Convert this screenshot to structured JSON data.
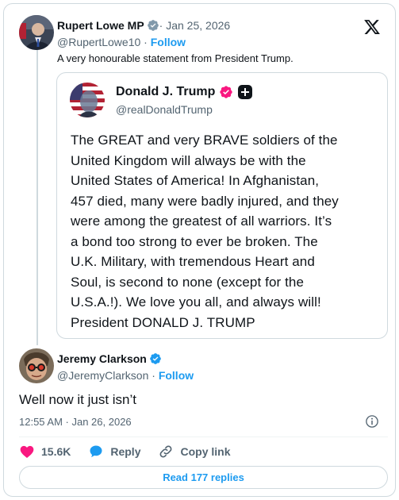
{
  "parent": {
    "name": "Rupert Lowe MP",
    "date": " · Jan 25, 2026",
    "handle": "@RupertLowe10",
    "separator": " · ",
    "follow": "Follow",
    "text": "A very honourable statement from President Trump."
  },
  "quote": {
    "name": "Donald J. Trump",
    "handle": "@realDonaldTrump",
    "lines": [
      "The GREAT and very BRAVE soldiers of the",
      "United Kingdom will always be with the",
      "United States of America! In Afghanistan,",
      "457 died, many were badly injured, and they",
      "were among the greatest of all warriors. It’s",
      "a bond too strong to ever be broken. The",
      "U.K. Military, with tremendous Heart and",
      "Soul, is second to none (except for the",
      "U.S.A.!). We love you all, and always will!",
      "President DONALD J. TRUMP"
    ]
  },
  "reply": {
    "name": "Jeremy Clarkson",
    "handle": "@JeremyClarkson",
    "separator": " · ",
    "follow": "Follow",
    "text": "Well now it just isn’t",
    "timestamp": "12:55 AM · Jan 26, 2026"
  },
  "actions": {
    "likes": "15.6K",
    "reply": "Reply",
    "copy_link": "Copy link"
  },
  "read_replies": "Read 177 replies",
  "icons": {
    "verified": "verified-badge-icon",
    "x_logo": "x-logo-icon",
    "heart": "heart-icon",
    "reply": "reply-bubble-icon",
    "link": "link-icon",
    "info": "info-icon"
  },
  "colors": {
    "accent": "#1d9bf0",
    "like": "#f91880",
    "text": "#0f1419",
    "muted": "#536471",
    "border": "#cfd9de",
    "affiliate_badge": "#f91880"
  }
}
